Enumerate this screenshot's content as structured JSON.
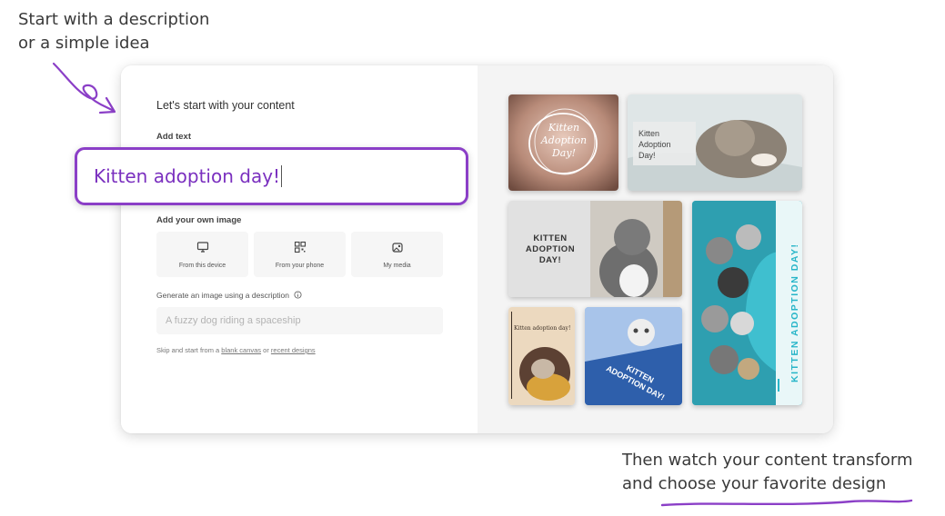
{
  "captions": {
    "top_line1": "Start with a description",
    "top_line2": "or a simple idea",
    "bottom_line1": "Then watch your content transform",
    "bottom_line2": "and choose your favorite design"
  },
  "panel": {
    "heading": "Let's start with your content",
    "add_text_label": "Add text",
    "text_value": "Kitten adoption day!",
    "own_image_label": "Add your own image",
    "upload_options": [
      {
        "label": "From this device",
        "icon": "monitor-icon"
      },
      {
        "label": "From your phone",
        "icon": "qr-code-icon"
      },
      {
        "label": "My media",
        "icon": "media-icon"
      }
    ],
    "generate_label": "Generate an image using a description",
    "generate_placeholder": "A fuzzy dog riding a spaceship",
    "skip_prefix": "Skip and start from a ",
    "blank_canvas": "blank canvas",
    "or": " or ",
    "recent_designs": "recent designs"
  },
  "designs": {
    "d1_text": "Kitten Adoption Day!",
    "d2_text": "Kitten Adoption Day!",
    "d3_text": "KITTEN ADOPTION DAY!",
    "d4_text": "KITTEN ADOPTION DAY!",
    "d5_text": "Kitten adoption day!",
    "d6_text": "KITTEN ADOPTION DAY!"
  },
  "colors": {
    "accent_purple": "#8b3fc7",
    "input_text": "#7a2fbf",
    "teal": "#27b5c8"
  }
}
